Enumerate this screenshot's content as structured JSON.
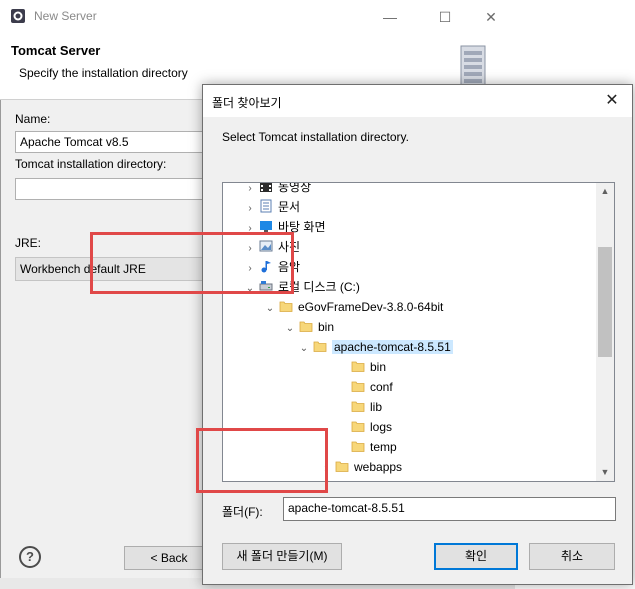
{
  "background_window": {
    "title": "New Server",
    "header_title": "Tomcat Server",
    "header_description": "Specify the installation directory",
    "name_label": "Name:",
    "name_value": "Apache Tomcat v8.5",
    "dir_label": "Tomcat installation directory:",
    "dir_value": "",
    "jre_label": "JRE:",
    "jre_value": "Workbench default JRE",
    "help_glyph": "?",
    "back_label": "< Back",
    "minimize_glyph": "—",
    "maximize_glyph": "☐",
    "close_glyph": "✕"
  },
  "folder_dialog": {
    "title": "폴더 찾아보기",
    "close_glyph": "✕",
    "instruction": "Select Tomcat installation directory.",
    "tree": [
      {
        "label": "동영상",
        "arrow": "›",
        "icon": "video-icon"
      },
      {
        "label": "문서",
        "arrow": "›",
        "icon": "document-icon"
      },
      {
        "label": "바탕 화면",
        "arrow": "›",
        "icon": "desktop-icon"
      },
      {
        "label": "사진",
        "arrow": "›",
        "icon": "picture-icon"
      },
      {
        "label": "음악",
        "arrow": "›",
        "icon": "music-icon"
      },
      {
        "label": "로컬 디스크 (C:)",
        "arrow": "⌄",
        "icon": "drive-icon"
      },
      {
        "label": "eGovFrameDev-3.8.0-64bit",
        "arrow": "⌄",
        "icon": "folder-icon"
      },
      {
        "label": "bin",
        "arrow": "⌄",
        "icon": "folder-icon"
      },
      {
        "label": "apache-tomcat-8.5.51",
        "arrow": "⌄",
        "icon": "folder-icon",
        "selected": true
      },
      {
        "label": "bin",
        "arrow": "",
        "icon": "folder-icon"
      },
      {
        "label": "conf",
        "arrow": "",
        "icon": "folder-icon"
      },
      {
        "label": "lib",
        "arrow": "",
        "icon": "folder-icon"
      },
      {
        "label": "logs",
        "arrow": "",
        "icon": "folder-icon"
      },
      {
        "label": "temp",
        "arrow": "",
        "icon": "folder-icon"
      },
      {
        "label": "webapps",
        "arrow": "›",
        "icon": "folder-icon"
      }
    ],
    "folder_label": "폴더(F):",
    "folder_value": "apache-tomcat-8.5.51",
    "new_folder_label": "새 폴더 만들기(M)",
    "ok_label": "확인",
    "cancel_label": "취소"
  },
  "colors": {
    "highlight": "#e04848",
    "selection": "#cce8ff",
    "focus_border": "#0078d7"
  }
}
